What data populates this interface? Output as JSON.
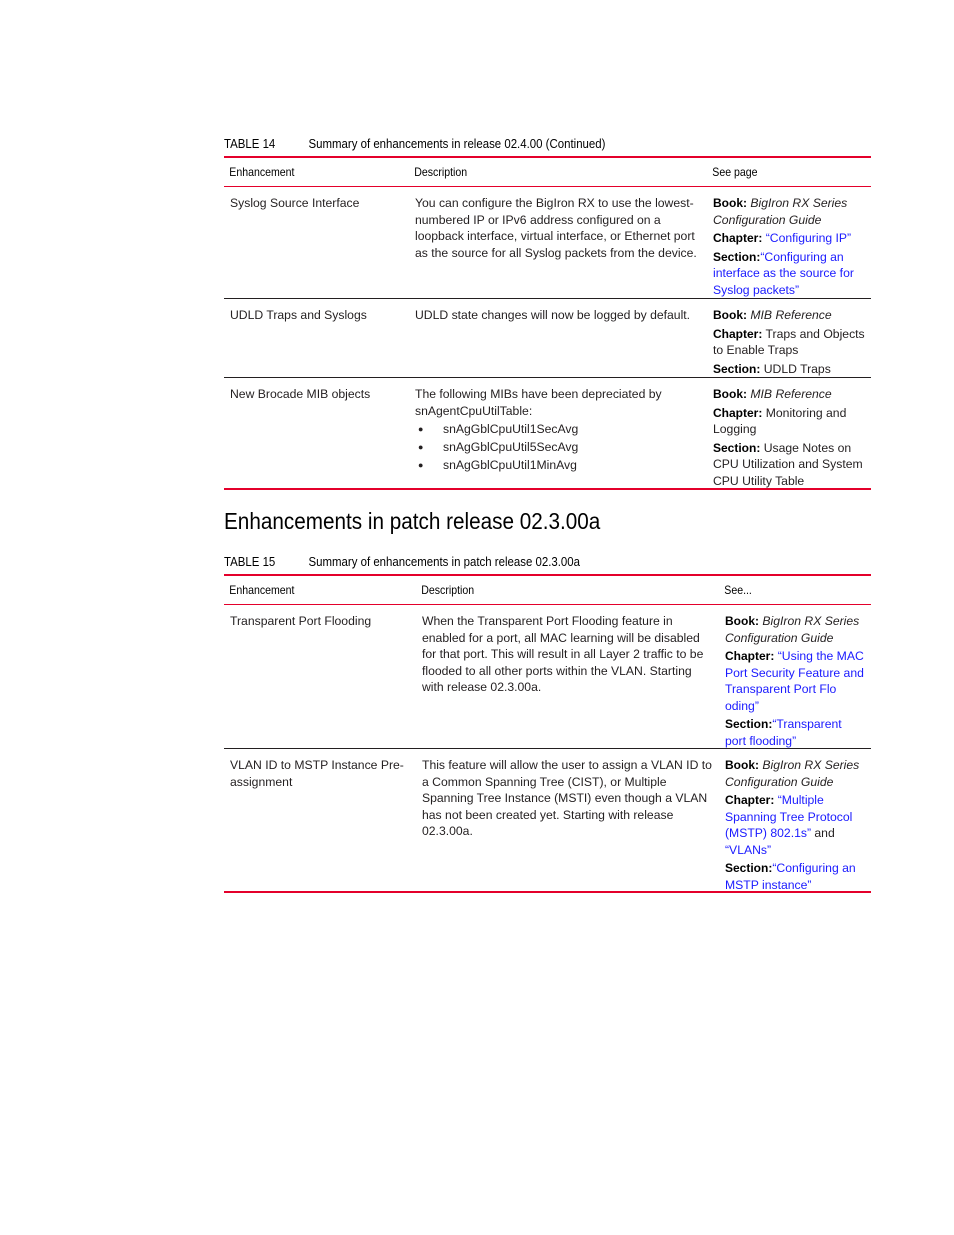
{
  "table14": {
    "caption_num": "TABLE 14",
    "caption_title": "Summary of enhancements in release 02.4.00 (Continued)",
    "headers": [
      "Enhancement",
      "Description",
      "See page"
    ],
    "rows": [
      {
        "enhancement": "Syslog Source Interface",
        "description": "You can configure the BigIron RX to use the lowest-numbered IP or IPv6 address configured on a loopback interface, virtual interface, or Ethernet port as the source for all Syslog packets from the device.",
        "book_label": "Book:",
        "book": "BigIron RX Series Configuration Guide",
        "chapter_label": "Chapter:",
        "chapter": "“Configuring IP”",
        "section_label": "Section:",
        "section": "“Configuring an interface as the source for Syslog packets”"
      },
      {
        "enhancement": "UDLD Traps and Syslogs",
        "description": "UDLD state changes will now be logged by default.",
        "book_label": "Book:",
        "book": "MIB Reference",
        "chapter_label": "Chapter:",
        "chapter": "Traps and Objects to Enable Traps",
        "section_label": "Section:",
        "section": "UDLD Traps"
      },
      {
        "enhancement": "New Brocade MIB objects",
        "description": "The following MIBs have been depreciated by snAgentCpuUtilTable:",
        "bullets": [
          "snAgGblCpuUtil1SecAvg",
          "snAgGblCpuUtil5SecAvg",
          "snAgGblCpuUtil1MinAvg"
        ],
        "book_label": "Book:",
        "book": "MIB Reference",
        "chapter_label": "Chapter:",
        "chapter": "Monitoring and Logging",
        "section_label": "Section:",
        "section": "Usage Notes on CPU Utilization and System CPU Utility Table"
      }
    ]
  },
  "section_heading": "Enhancements in patch release 02.3.00a",
  "table15": {
    "caption_num": "TABLE 15",
    "caption_title": "Summary of enhancements in patch release 02.3.00a",
    "headers": [
      "Enhancement",
      "Description",
      "See..."
    ],
    "rows": [
      {
        "enhancement": "Transparent Port Flooding",
        "description": "When the Transparent Port Flooding feature in enabled for a port, all MAC learning will be disabled for that port. This will result in all Layer 2 traffic to be flooded to all other ports within the VLAN. Starting with release 02.3.00a.",
        "book_label": "Book:",
        "book": "BigIron RX Series Configuration Guide",
        "chapter_label": "Chapter:",
        "chapter": "“Using the MAC Port Security Feature and Transparent Port Flo oding”",
        "section_label": "Section:",
        "section": "“Transparent port flooding”"
      },
      {
        "enhancement": "VLAN ID to MSTP Instance Pre-assignment",
        "description": "This feature will allow the user to assign a VLAN ID to a Common Spanning Tree (CIST), or Multiple Spanning Tree Instance (MSTI) even though a VLAN has not been created yet. Starting with release 02.3.00a.",
        "book_label": "Book:",
        "book": "BigIron RX Series Configuration Guide",
        "chapter_label": "Chapter:",
        "chapter": "“Multiple Spanning Tree Protocol (MSTP) 802.1s”",
        "chapter_joiner": "and",
        "chapter2": "“VLANs”",
        "section_label": "Section:",
        "section": "“Configuring an MSTP instance”"
      }
    ]
  },
  "colors": {
    "rule_red": "#e4002b",
    "link_blue": "#1a1aff"
  }
}
